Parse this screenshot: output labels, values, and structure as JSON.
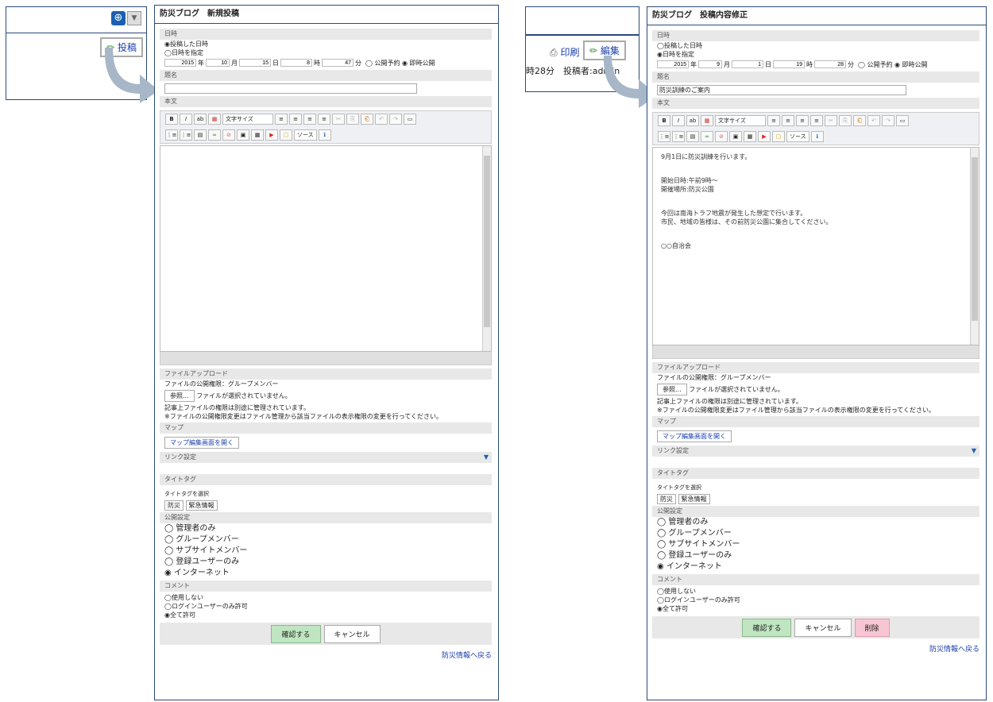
{
  "left": {
    "post_label": "投稿",
    "form": {
      "title": "防災ブログ　新規投稿",
      "date_section": "日時",
      "date_opt1": "◉投稿した日時",
      "date_opt2": "◯日時を指定",
      "date": {
        "year": "2015",
        "year_u": "年",
        "month": "10",
        "month_u": "月",
        "day": "15",
        "day_u": "日",
        "hour": "8",
        "hour_u": "時",
        "min": "47",
        "min_u": "分"
      },
      "time_opts": "◯ 公開予約 ◉ 即時公開",
      "title_section": "題名",
      "title_value": "",
      "body_section": "本文",
      "body_lines": []
    }
  },
  "right": {
    "print_label": "印刷",
    "edit_label": "編集",
    "meta": "時28分　投稿者:admin",
    "form": {
      "title": "防災ブログ　投稿内容修正",
      "date_section": "日時",
      "date_opt1": "◯投稿した日時",
      "date_opt2": "◉日時を指定",
      "date": {
        "year": "2015",
        "year_u": "年",
        "month": "9",
        "month_u": "月",
        "day": "1",
        "day_u": "日",
        "hour": "19",
        "hour_u": "時",
        "min": "28",
        "min_u": "分"
      },
      "time_opts": "◯ 公開予約 ◉ 即時公開",
      "title_section": "題名",
      "title_value": "防災訓練のご案内",
      "body_section": "本文",
      "body_lines": [
        "9月1日に防災訓練を行います。",
        "",
        "開始日時:午前9時〜",
        "開催場所:防災公園",
        "",
        "今回は南海トラフ地震が発生した想定で行います。",
        "市民、地域の皆様は、その前防災公園に集合してください。",
        "",
        "○○自治会"
      ]
    }
  },
  "common": {
    "toolbar1": [
      "B",
      "I",
      "ab",
      "▦",
      "文字サイズ",
      "≡",
      "≡",
      "≡",
      "≡",
      "✂",
      "⎘",
      "⎗",
      "↶",
      "↷",
      "▭"
    ],
    "toolbar2": [
      "⋮≡",
      "⋮≡",
      "▤",
      "∞",
      "⊘",
      "▣",
      "▦",
      "▶",
      "▢",
      "ソース",
      "ℹ"
    ],
    "upload_section": "ファイルアップロード",
    "upload_perm": "ファイルの公開権限：グループメンバー",
    "browse": "参照...",
    "no_file": "ファイルが選択されていません。",
    "note1": "記事上ファイルの権限は別途に管理されています。",
    "note2": "※ファイルの公開権限変更はファイル管理から該当ファイルの表示権限の変更を行ってください。",
    "map_section": "マップ",
    "map_button": "マップ編集画面を開く",
    "link_section": "リンク設定",
    "tag_section": "タイトタグ",
    "tag_label": "タイトタグを選択",
    "tags": [
      "防災",
      "緊急情報"
    ],
    "pub_section": "公開設定",
    "pub_opts": [
      "◯ 管理者のみ",
      "◯ グループメンバー",
      "◯ サブサイトメンバー",
      "◯ 登録ユーザーのみ",
      "◉ インターネット"
    ],
    "comment_section": "コメント",
    "comment_opts": [
      "◯使用しない",
      "◯ログインユーザーのみ許可",
      "◉全て許可"
    ],
    "confirm": "確認する",
    "cancel": "キャンセル",
    "delete": "削除",
    "back": "防災情報へ戻る"
  }
}
